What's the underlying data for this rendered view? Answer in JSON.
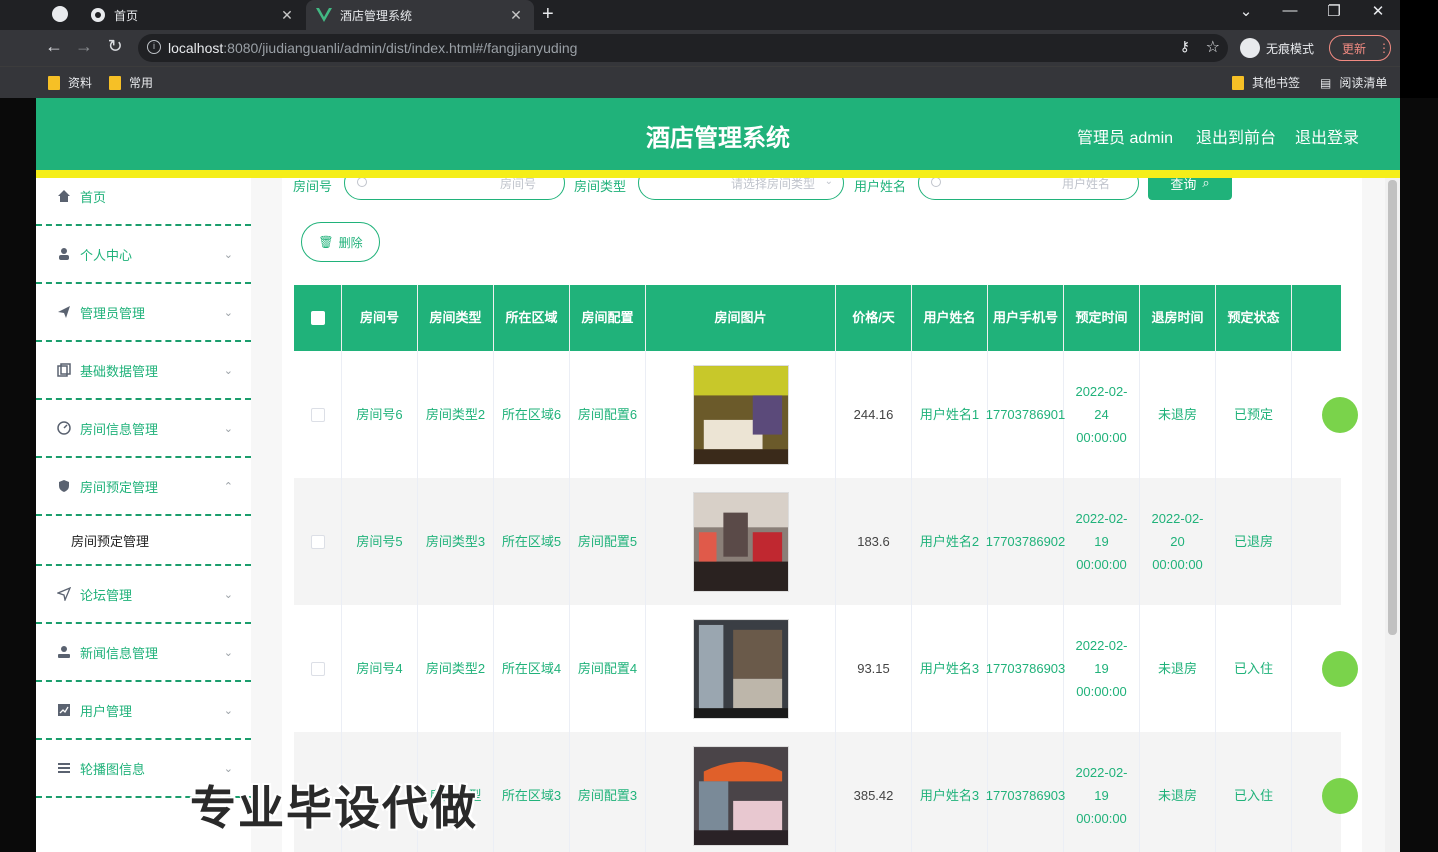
{
  "browser": {
    "tabs": [
      {
        "label": "首页"
      },
      {
        "label": "酒店管理系统"
      }
    ],
    "url_host": "localhost",
    "url_rest": ":8080/jiudianguanli/admin/dist/index.html#/fangjianyuding",
    "profile": "无痕模式",
    "update": "更新",
    "bookmarks": [
      "资料",
      "常用",
      "其他书签",
      "阅读清单"
    ]
  },
  "header": {
    "title": "酒店管理系统",
    "admin": "管理员 admin",
    "front": "退出到前台",
    "logout": "退出登录"
  },
  "sidebar": {
    "items": [
      {
        "label": "首页"
      },
      {
        "label": "个人中心"
      },
      {
        "label": "管理员管理"
      },
      {
        "label": "基础数据管理"
      },
      {
        "label": "房间信息管理"
      },
      {
        "label": "房间预定管理"
      },
      {
        "label": "房间预定管理"
      },
      {
        "label": "论坛管理"
      },
      {
        "label": "新闻信息管理"
      },
      {
        "label": "用户管理"
      },
      {
        "label": "轮播图信息"
      }
    ]
  },
  "search": {
    "room_label": "房间号",
    "room_placeholder": "房间号",
    "type_label": "房间类型",
    "type_placeholder": "请选择房间类型",
    "user_label": "用户姓名",
    "user_placeholder": "用户姓名",
    "query": "查询"
  },
  "delete_label": "删除",
  "table": {
    "headers": [
      "房间号",
      "房间类型",
      "所在区域",
      "房间配置",
      "房间图片",
      "价格/天",
      "用户姓名",
      "用户手机号",
      "预定时间",
      "退房时间",
      "预定状态"
    ],
    "rows": [
      {
        "room": "房间号6",
        "type": "房间类型2",
        "area": "所在区域6",
        "config": "房间配置6",
        "price": "244.16",
        "user": "用户姓名1",
        "phone": "17703786901",
        "book": "2022-02-24 00:00:00",
        "checkout": "未退房",
        "status": "已预定"
      },
      {
        "room": "房间号5",
        "type": "房间类型3",
        "area": "所在区域5",
        "config": "房间配置5",
        "price": "183.6",
        "user": "用户姓名2",
        "phone": "17703786902",
        "book": "2022-02-19 00:00:00",
        "checkout": "2022-02-20 00:00:00",
        "status": "已退房"
      },
      {
        "room": "房间号4",
        "type": "房间类型2",
        "area": "所在区域4",
        "config": "房间配置4",
        "price": "93.15",
        "user": "用户姓名3",
        "phone": "17703786903",
        "book": "2022-02-19 00:00:00",
        "checkout": "未退房",
        "status": "已入住"
      },
      {
        "room": "",
        "type": "房间类型",
        "area": "所在区域3",
        "config": "房间配置3",
        "price": "385.42",
        "user": "用户姓名3",
        "phone": "17703786903",
        "book": "2022-02-19 00:00:00",
        "checkout": "未退房",
        "status": "已入住"
      }
    ]
  },
  "watermark": "专业毕设代做",
  "colors": {
    "primary": "#20b27a",
    "accent_line": "#f5ee19",
    "action": "#7ad34b"
  }
}
